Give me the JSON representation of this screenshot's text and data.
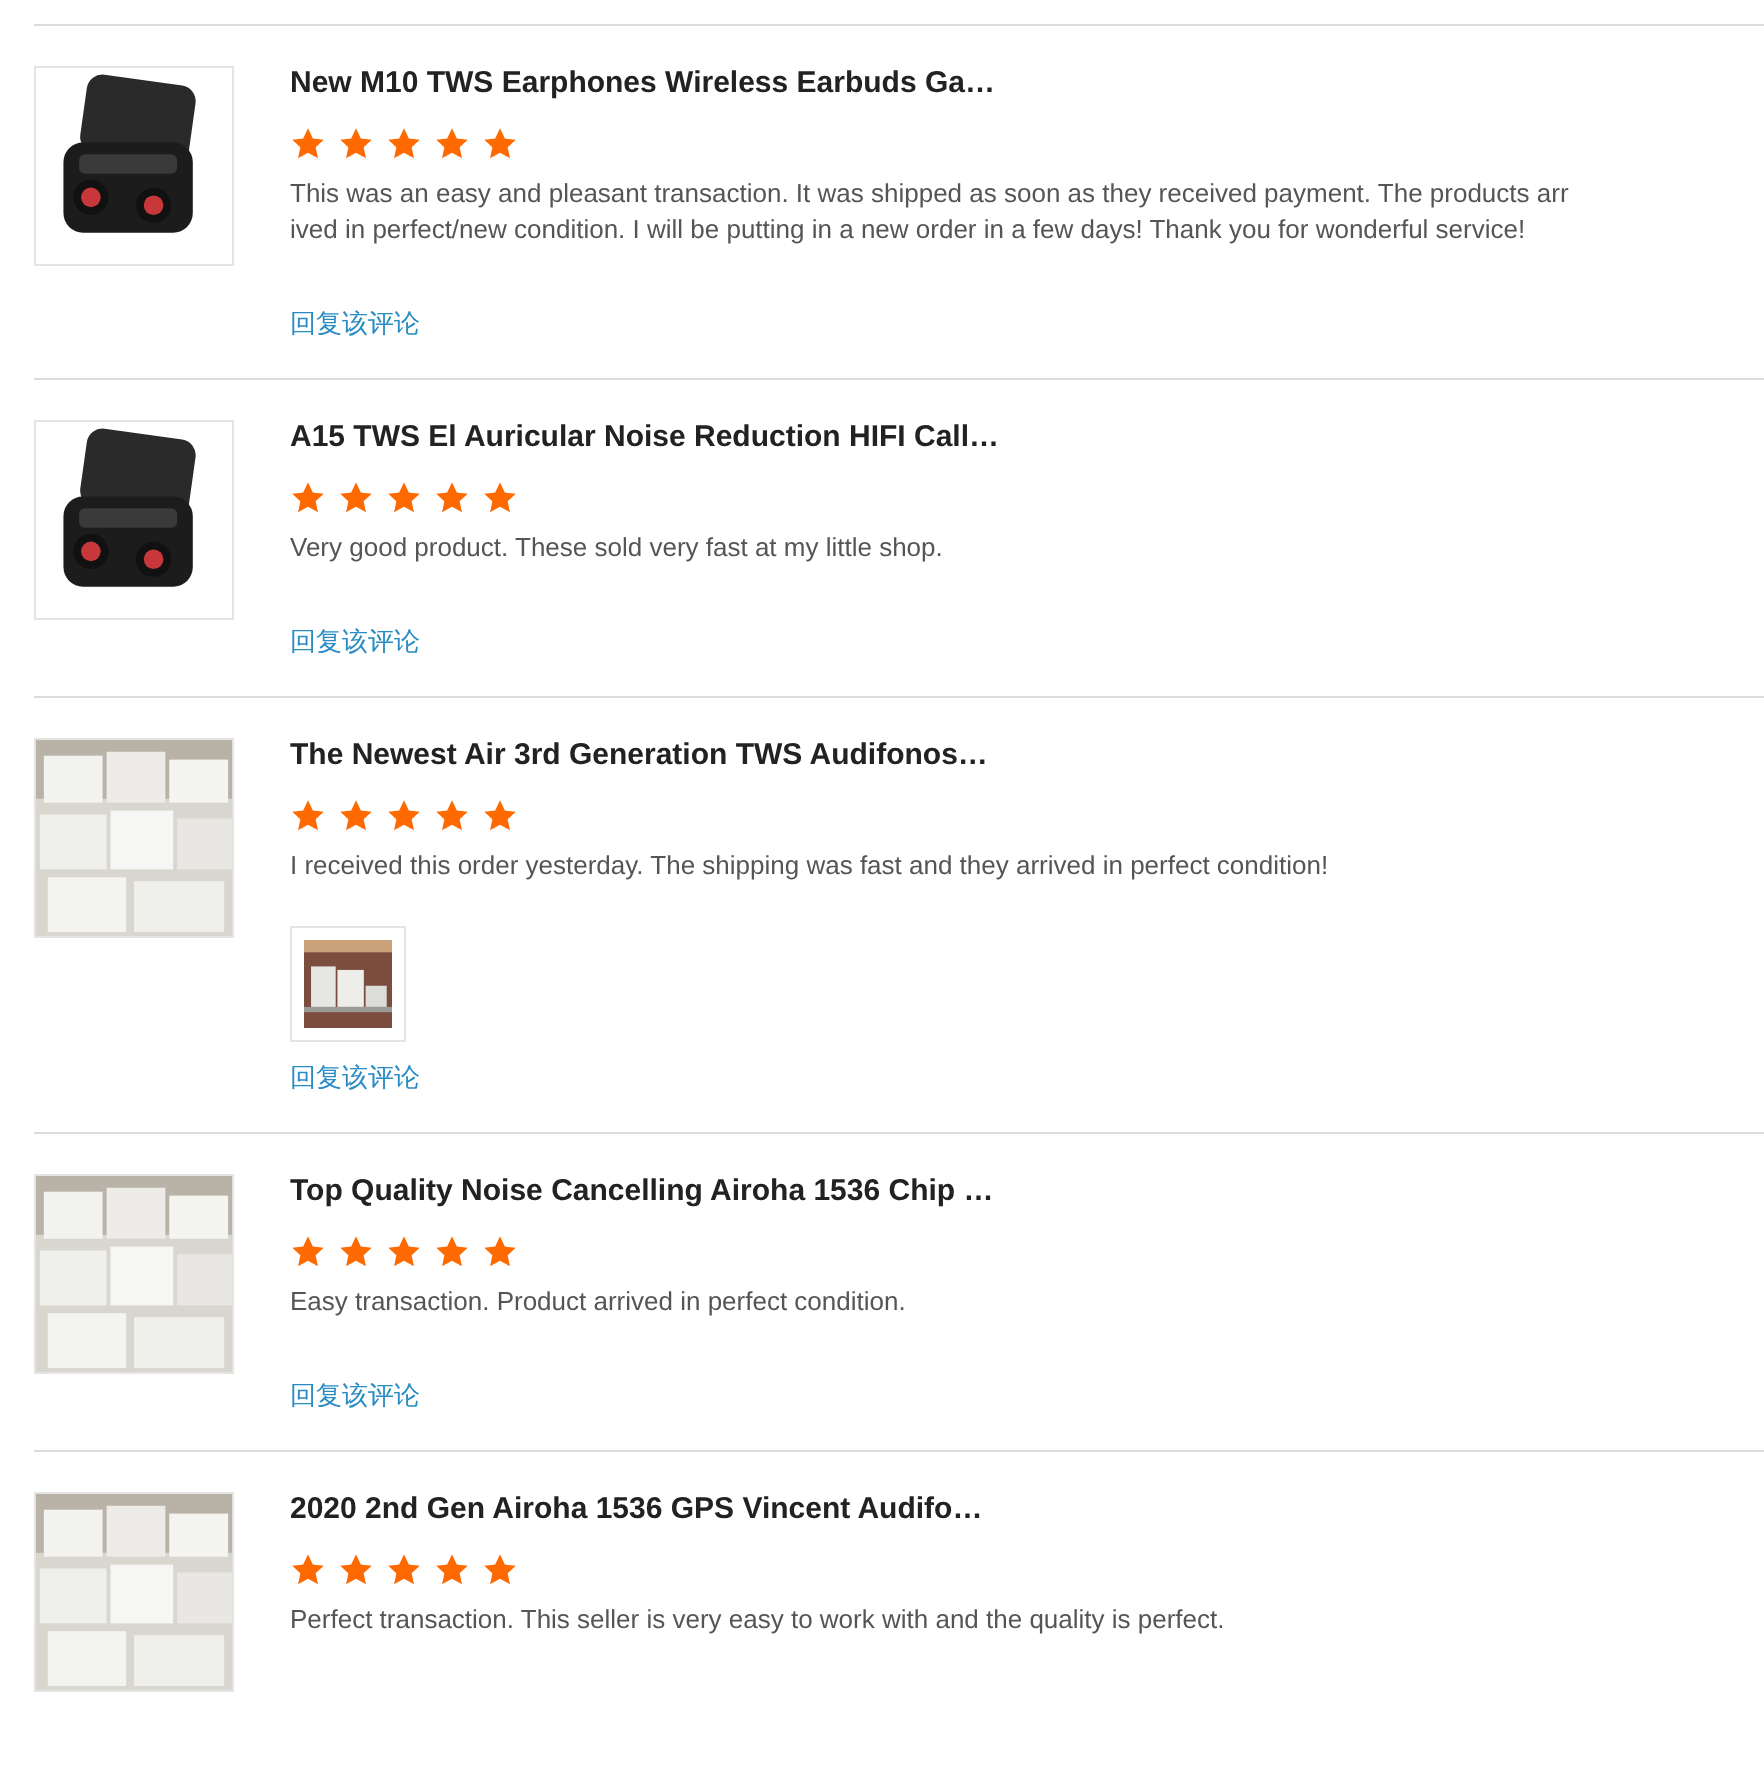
{
  "reviews": [
    {
      "title": "New M10 TWS Earphones Wireless Earbuds Ga…",
      "stars": 5,
      "text": "This was an easy and pleasant transaction. It was shipped as soon as they received payment. The products arrived in perfect/new condition. I will be putting in a new order in a few days! Thank you for wonderful service!",
      "reply": "回复该评论"
    },
    {
      "title": "A15 TWS El Auricular Noise Reduction HIFI Call…",
      "stars": 5,
      "text": "Very good product. These sold very fast at my little shop.",
      "reply": "回复该评论"
    },
    {
      "title": "The Newest Air 3rd Generation TWS Audifonos…",
      "stars": 5,
      "text": "I received this order yesterday. The shipping was fast and they arrived in perfect condition!",
      "photos": [
        {
          "kind": "picture"
        }
      ],
      "reply": "回复该评论"
    },
    {
      "title": "Top Quality Noise Cancelling Airoha 1536 Chip …",
      "stars": 5,
      "text": "Easy transaction. Product arrived in perfect condition.",
      "reply": "回复该评论"
    },
    {
      "title": "2020 2nd Gen Airoha 1536 GPS Vincent Audifo…",
      "stars": 5,
      "text": "Perfect transaction. This seller is very easy to work with and the quality is perfect."
    }
  ]
}
